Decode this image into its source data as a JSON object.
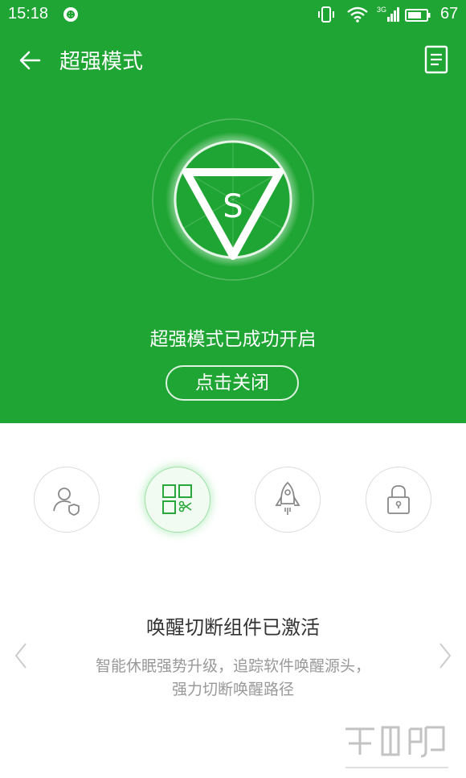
{
  "status_bar": {
    "time": "15:18",
    "network": "3G",
    "battery_level": "67"
  },
  "header": {
    "title": "超强模式"
  },
  "hero": {
    "emblem_letter": "S",
    "status_text": "超强模式已成功开启",
    "close_label": "点击关闭"
  },
  "features": {
    "items": [
      {
        "icon": "user-shield-icon",
        "active": false
      },
      {
        "icon": "grid-scissors-icon",
        "active": true
      },
      {
        "icon": "rocket-icon",
        "active": false
      },
      {
        "icon": "lock-icon",
        "active": false
      }
    ],
    "title": "唤醒切断组件已激活",
    "description": "智能休眠强势升级，追踪软件唤醒源头，强力切断唤醒路径"
  },
  "colors": {
    "primary_green": "#1fa533",
    "text_dark": "#333333",
    "text_muted": "#999999"
  }
}
